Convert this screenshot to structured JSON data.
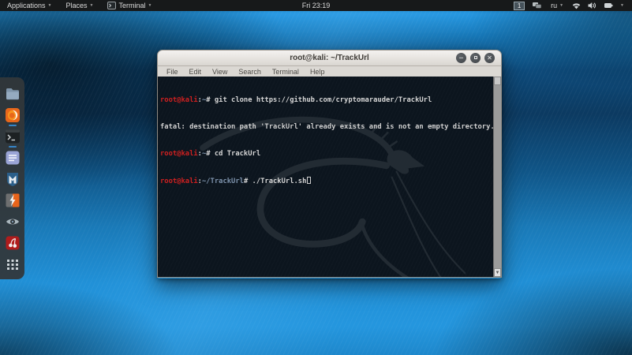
{
  "panel": {
    "applications": "Applications",
    "places": "Places",
    "terminal": "Terminal",
    "clock": "Fri 23:19",
    "workspace": "1",
    "keyboard_layout": "ru"
  },
  "dock": {
    "icons": [
      "files-icon",
      "browser-icon",
      "terminal-icon",
      "text-editor-icon",
      "metasploit-icon",
      "armitage-icon",
      "eye-icon",
      "cherrytree-icon",
      "app-grid-icon"
    ],
    "running": [
      "browser-icon",
      "terminal-icon"
    ]
  },
  "window": {
    "title": "root@kali: ~/TrackUrl",
    "menus": [
      "File",
      "Edit",
      "View",
      "Search",
      "Terminal",
      "Help"
    ],
    "buttons": [
      "minimize",
      "maximize",
      "close"
    ]
  },
  "terminal": {
    "lines": [
      {
        "user": "root@kali",
        "sep": ":",
        "path": "~",
        "sym": "#",
        "cmd": " git clone https://github.com/cryptomarauder/TrackUrl"
      },
      {
        "out": "fatal: destination path 'TrackUrl' already exists and is not an empty directory."
      },
      {
        "user": "root@kali",
        "sep": ":",
        "path": "~",
        "sym": "#",
        "cmd": " cd TrackUrl"
      },
      {
        "user": "root@kali",
        "sep": ":",
        "path": "~/TrackUrl",
        "sym": "#",
        "cmd": " ./TrackUrl.sh"
      }
    ]
  },
  "colors": {
    "prompt_red": "#cf2020",
    "prompt_path_blue": "#7e93ad",
    "terminal_bg": "#0c151e",
    "panel_bg": "#17191a",
    "accent_blue": "#3584c7",
    "titlebar": "#e6e3df"
  }
}
